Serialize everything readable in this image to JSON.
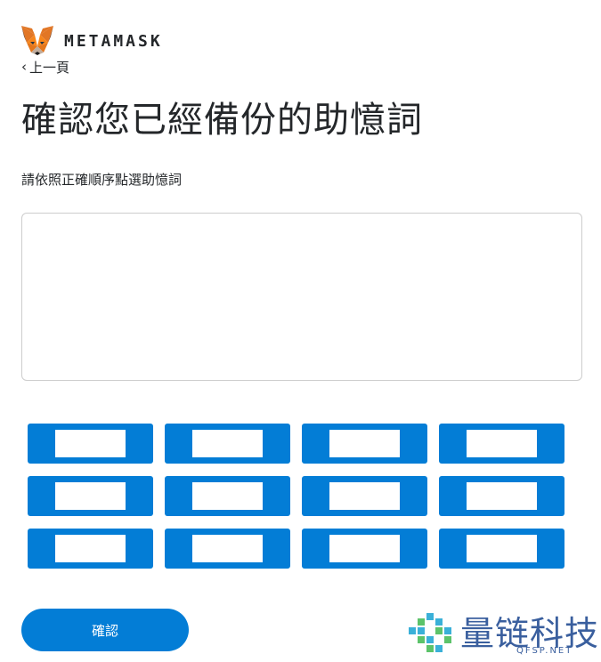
{
  "brand": {
    "name": "METAMASK",
    "logo_icon": "metamask-fox-icon"
  },
  "nav": {
    "back_label": "上一頁",
    "back_icon": "chevron-left-icon"
  },
  "page": {
    "title": "確認您已經備份的助憶詞",
    "instruction": "請依照正確順序點選助憶詞"
  },
  "selected_words": [],
  "word_buttons": [
    {
      "label": ""
    },
    {
      "label": ""
    },
    {
      "label": ""
    },
    {
      "label": ""
    },
    {
      "label": ""
    },
    {
      "label": ""
    },
    {
      "label": ""
    },
    {
      "label": ""
    },
    {
      "label": ""
    },
    {
      "label": ""
    },
    {
      "label": ""
    },
    {
      "label": ""
    }
  ],
  "actions": {
    "confirm_label": "確認"
  },
  "watermark": {
    "text": "量链科技",
    "url": "QFSP.NET",
    "icon": "quantum-chain-logo-icon"
  },
  "colors": {
    "primary": "#037dd6",
    "text": "#24272a",
    "border": "#cdcdcd",
    "watermark": "#3a5f9e"
  }
}
